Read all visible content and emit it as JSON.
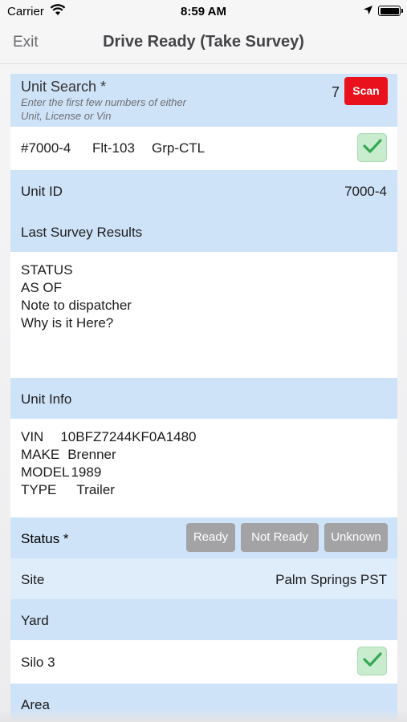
{
  "status_bar": {
    "carrier": "Carrier",
    "time": "8:59 AM"
  },
  "nav": {
    "back_label": "Exit",
    "title": "Drive Ready (Take Survey)"
  },
  "unit_search": {
    "label": "Unit Search *",
    "hint": "Enter the first few numbers of either Unit, License or Vin",
    "value": "7",
    "scan_label": "Scan"
  },
  "result": {
    "unit": "#7000-4",
    "fleet": "Flt-103",
    "group": "Grp-CTL"
  },
  "unit_id": {
    "label": "Unit ID",
    "value": "7000-4"
  },
  "last_survey": {
    "label": "Last Survey Results",
    "lines": [
      "STATUS",
      "AS OF",
      "Note to dispatcher",
      "Why is it Here?"
    ]
  },
  "unit_info": {
    "label": "Unit Info",
    "vin_key": "VIN",
    "vin_value": "10BFZ7244KF0A1480",
    "make_key": "MAKE",
    "make_value": "Brenner",
    "model_key": "MODEL",
    "model_value": "1989",
    "type_key": "TYPE",
    "type_value": "Trailer"
  },
  "status": {
    "label": "Status *",
    "options": [
      "Ready",
      "Not Ready",
      "Unknown"
    ]
  },
  "site": {
    "label": "Site",
    "value": "Palm Springs PST"
  },
  "yard": {
    "label": "Yard"
  },
  "silo": {
    "label": "Silo 3"
  },
  "area": {
    "label": "Area"
  },
  "colors": {
    "scan": "#e8111c",
    "check": "#34a853",
    "row_blue": "#cfe3f8",
    "pill": "#a3a3a6"
  },
  "icons": [
    "wifi-icon",
    "location-arrow-icon",
    "battery-icon",
    "checkmark-icon"
  ]
}
